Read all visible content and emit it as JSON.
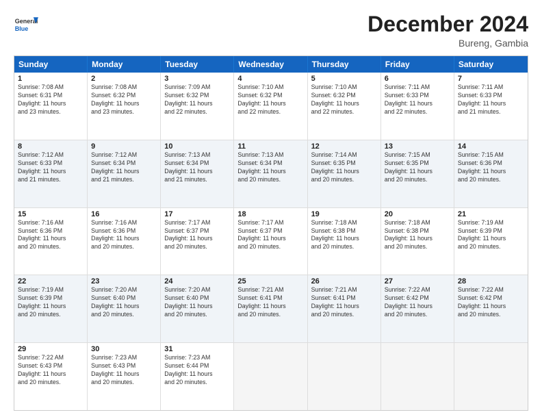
{
  "logo": {
    "line1": "General",
    "line2": "Blue"
  },
  "title": "December 2024",
  "location": "Bureng, Gambia",
  "header_days": [
    "Sunday",
    "Monday",
    "Tuesday",
    "Wednesday",
    "Thursday",
    "Friday",
    "Saturday"
  ],
  "weeks": [
    [
      {
        "day": "1",
        "lines": [
          "Sunrise: 7:08 AM",
          "Sunset: 6:31 PM",
          "Daylight: 11 hours",
          "and 23 minutes."
        ]
      },
      {
        "day": "2",
        "lines": [
          "Sunrise: 7:08 AM",
          "Sunset: 6:32 PM",
          "Daylight: 11 hours",
          "and 23 minutes."
        ]
      },
      {
        "day": "3",
        "lines": [
          "Sunrise: 7:09 AM",
          "Sunset: 6:32 PM",
          "Daylight: 11 hours",
          "and 22 minutes."
        ]
      },
      {
        "day": "4",
        "lines": [
          "Sunrise: 7:10 AM",
          "Sunset: 6:32 PM",
          "Daylight: 11 hours",
          "and 22 minutes."
        ]
      },
      {
        "day": "5",
        "lines": [
          "Sunrise: 7:10 AM",
          "Sunset: 6:32 PM",
          "Daylight: 11 hours",
          "and 22 minutes."
        ]
      },
      {
        "day": "6",
        "lines": [
          "Sunrise: 7:11 AM",
          "Sunset: 6:33 PM",
          "Daylight: 11 hours",
          "and 22 minutes."
        ]
      },
      {
        "day": "7",
        "lines": [
          "Sunrise: 7:11 AM",
          "Sunset: 6:33 PM",
          "Daylight: 11 hours",
          "and 21 minutes."
        ]
      }
    ],
    [
      {
        "day": "8",
        "lines": [
          "Sunrise: 7:12 AM",
          "Sunset: 6:33 PM",
          "Daylight: 11 hours",
          "and 21 minutes."
        ]
      },
      {
        "day": "9",
        "lines": [
          "Sunrise: 7:12 AM",
          "Sunset: 6:34 PM",
          "Daylight: 11 hours",
          "and 21 minutes."
        ]
      },
      {
        "day": "10",
        "lines": [
          "Sunrise: 7:13 AM",
          "Sunset: 6:34 PM",
          "Daylight: 11 hours",
          "and 21 minutes."
        ]
      },
      {
        "day": "11",
        "lines": [
          "Sunrise: 7:13 AM",
          "Sunset: 6:34 PM",
          "Daylight: 11 hours",
          "and 20 minutes."
        ]
      },
      {
        "day": "12",
        "lines": [
          "Sunrise: 7:14 AM",
          "Sunset: 6:35 PM",
          "Daylight: 11 hours",
          "and 20 minutes."
        ]
      },
      {
        "day": "13",
        "lines": [
          "Sunrise: 7:15 AM",
          "Sunset: 6:35 PM",
          "Daylight: 11 hours",
          "and 20 minutes."
        ]
      },
      {
        "day": "14",
        "lines": [
          "Sunrise: 7:15 AM",
          "Sunset: 6:36 PM",
          "Daylight: 11 hours",
          "and 20 minutes."
        ]
      }
    ],
    [
      {
        "day": "15",
        "lines": [
          "Sunrise: 7:16 AM",
          "Sunset: 6:36 PM",
          "Daylight: 11 hours",
          "and 20 minutes."
        ]
      },
      {
        "day": "16",
        "lines": [
          "Sunrise: 7:16 AM",
          "Sunset: 6:36 PM",
          "Daylight: 11 hours",
          "and 20 minutes."
        ]
      },
      {
        "day": "17",
        "lines": [
          "Sunrise: 7:17 AM",
          "Sunset: 6:37 PM",
          "Daylight: 11 hours",
          "and 20 minutes."
        ]
      },
      {
        "day": "18",
        "lines": [
          "Sunrise: 7:17 AM",
          "Sunset: 6:37 PM",
          "Daylight: 11 hours",
          "and 20 minutes."
        ]
      },
      {
        "day": "19",
        "lines": [
          "Sunrise: 7:18 AM",
          "Sunset: 6:38 PM",
          "Daylight: 11 hours",
          "and 20 minutes."
        ]
      },
      {
        "day": "20",
        "lines": [
          "Sunrise: 7:18 AM",
          "Sunset: 6:38 PM",
          "Daylight: 11 hours",
          "and 20 minutes."
        ]
      },
      {
        "day": "21",
        "lines": [
          "Sunrise: 7:19 AM",
          "Sunset: 6:39 PM",
          "Daylight: 11 hours",
          "and 20 minutes."
        ]
      }
    ],
    [
      {
        "day": "22",
        "lines": [
          "Sunrise: 7:19 AM",
          "Sunset: 6:39 PM",
          "Daylight: 11 hours",
          "and 20 minutes."
        ]
      },
      {
        "day": "23",
        "lines": [
          "Sunrise: 7:20 AM",
          "Sunset: 6:40 PM",
          "Daylight: 11 hours",
          "and 20 minutes."
        ]
      },
      {
        "day": "24",
        "lines": [
          "Sunrise: 7:20 AM",
          "Sunset: 6:40 PM",
          "Daylight: 11 hours",
          "and 20 minutes."
        ]
      },
      {
        "day": "25",
        "lines": [
          "Sunrise: 7:21 AM",
          "Sunset: 6:41 PM",
          "Daylight: 11 hours",
          "and 20 minutes."
        ]
      },
      {
        "day": "26",
        "lines": [
          "Sunrise: 7:21 AM",
          "Sunset: 6:41 PM",
          "Daylight: 11 hours",
          "and 20 minutes."
        ]
      },
      {
        "day": "27",
        "lines": [
          "Sunrise: 7:22 AM",
          "Sunset: 6:42 PM",
          "Daylight: 11 hours",
          "and 20 minutes."
        ]
      },
      {
        "day": "28",
        "lines": [
          "Sunrise: 7:22 AM",
          "Sunset: 6:42 PM",
          "Daylight: 11 hours",
          "and 20 minutes."
        ]
      }
    ],
    [
      {
        "day": "29",
        "lines": [
          "Sunrise: 7:22 AM",
          "Sunset: 6:43 PM",
          "Daylight: 11 hours",
          "and 20 minutes."
        ]
      },
      {
        "day": "30",
        "lines": [
          "Sunrise: 7:23 AM",
          "Sunset: 6:43 PM",
          "Daylight: 11 hours",
          "and 20 minutes."
        ]
      },
      {
        "day": "31",
        "lines": [
          "Sunrise: 7:23 AM",
          "Sunset: 6:44 PM",
          "Daylight: 11 hours",
          "and 20 minutes."
        ]
      },
      {
        "day": "",
        "lines": []
      },
      {
        "day": "",
        "lines": []
      },
      {
        "day": "",
        "lines": []
      },
      {
        "day": "",
        "lines": []
      }
    ]
  ]
}
